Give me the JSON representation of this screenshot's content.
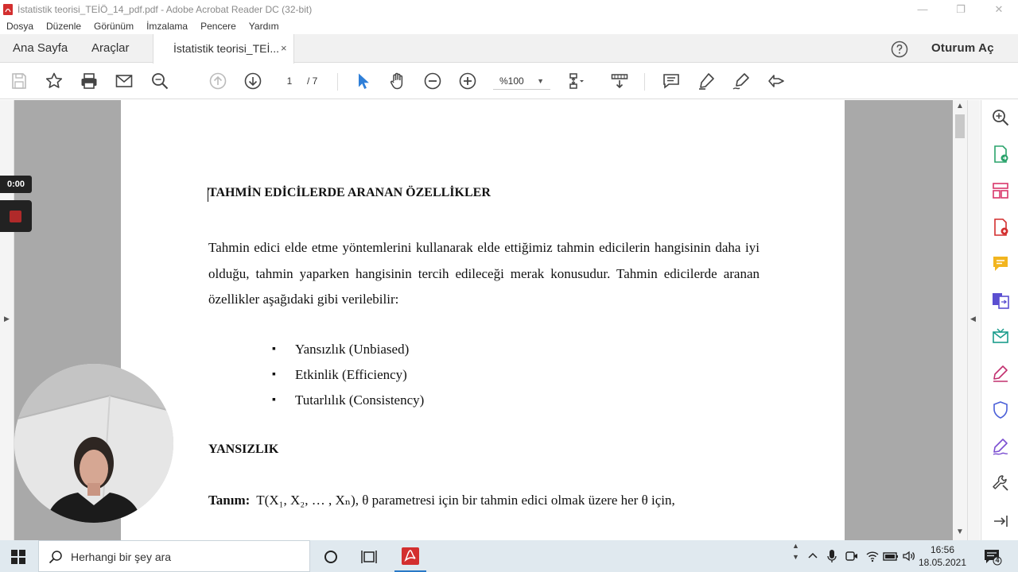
{
  "window": {
    "title": "İstatistik teorisi_TEİÖ_14_pdf.pdf - Adobe Acrobat Reader DC (32-bit)"
  },
  "menu": [
    "Dosya",
    "Düzenle",
    "Görünüm",
    "İmzalama",
    "Pencere",
    "Yardım"
  ],
  "tabs": {
    "home": "Ana Sayfa",
    "tools": "Araçlar",
    "document": "İstatistik teorisi_TEİ...",
    "close": "×",
    "sign_in": "Oturum Aç"
  },
  "toolbar": {
    "page_current": "1",
    "page_total": "/ 7",
    "zoom": "%100"
  },
  "document": {
    "heading1": "TAHMİN EDİCİLERDE ARANAN ÖZELLİKLER",
    "paragraph": "Tahmin edici elde etme yöntemlerini kullanarak elde ettiğimiz tahmin edicilerin hangisinin daha iyi olduğu, tahmin yaparken hangisinin tercih edileceği merak konusudur. Tahmin edicilerde aranan özellikler aşağıdaki gibi verilebilir:",
    "bullets": [
      "Yansızlık (Unbiased)",
      "Etkinlik (Efficiency)",
      "Tutarlılık (Consistency)"
    ],
    "heading2": "YANSIZLIK",
    "definition_label": "Tanım:",
    "definition_text": "T(X₁, X₂, … , Xₙ), θ parametresi için bir tahmin edici olmak üzere her θ için,"
  },
  "recorder": {
    "time": "0:00"
  },
  "taskbar": {
    "search_placeholder": "Herhangi bir şey ara",
    "time": "16:56",
    "date": "18.05.2021",
    "notifications": "4"
  },
  "colors": {
    "acrobat_red": "#d32f2f",
    "select_blue": "#2f7fd8",
    "taskbar": "#e0e9ef",
    "gray_margin": "#a9a9a9"
  }
}
